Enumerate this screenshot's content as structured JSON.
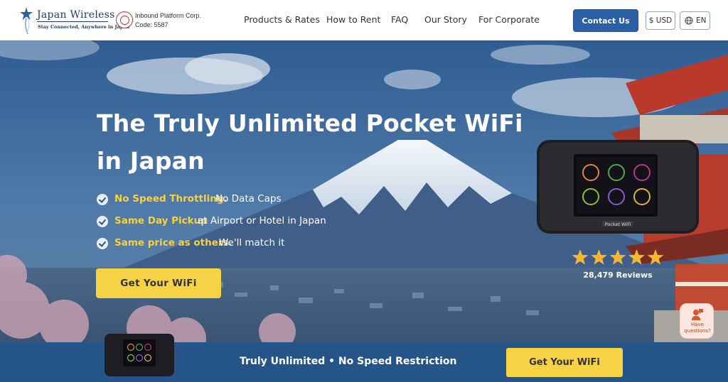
{
  "header": {
    "logo": {
      "name": "Japan Wireless",
      "tagline": "Stay Connected, Anywhere in Japan"
    },
    "corp": {
      "line1": "Inbound Platform Corp.",
      "line2": "Code: 5587"
    },
    "nav": [
      {
        "label": "Products & Rates"
      },
      {
        "label": "How to Rent"
      },
      {
        "label": "FAQ"
      },
      {
        "label": "Our Story"
      },
      {
        "label": "For Corporate"
      }
    ],
    "contact_label": "Contact Us",
    "currency_label": "$ USD",
    "language_label": "EN"
  },
  "hero": {
    "title_line1": "The Truly Unlimited Pocket WiFi",
    "title_line2": "in Japan",
    "features": [
      {
        "highlight": "No Speed Throttling.",
        "text": "No Data Caps"
      },
      {
        "highlight": "Same Day Pickup",
        "text": "at Airport or Hotel in Japan"
      },
      {
        "highlight": "Same price as others.",
        "text": "We'll match it"
      }
    ],
    "cta_label": "Get Your WiFi",
    "rating_stars": 5,
    "reviews_label": "28,479 Reviews",
    "device_brand": "Pocket WiFi"
  },
  "chat": {
    "line1": "Have",
    "line2": "questions?"
  },
  "banner": {
    "text": "Truly Unlimited • No Speed Restriction",
    "cta_label": "Get Your WiFi"
  },
  "colors": {
    "primary": "#2b5fa6",
    "banner": "#255489",
    "accent_yellow": "#f6d344",
    "highlight_text": "#f7d23c",
    "chat_accent": "#e0522d"
  },
  "icons": {
    "globe": "globe-icon",
    "check": "check-circle-icon",
    "star": "star-icon",
    "chat": "chat-person-icon"
  }
}
